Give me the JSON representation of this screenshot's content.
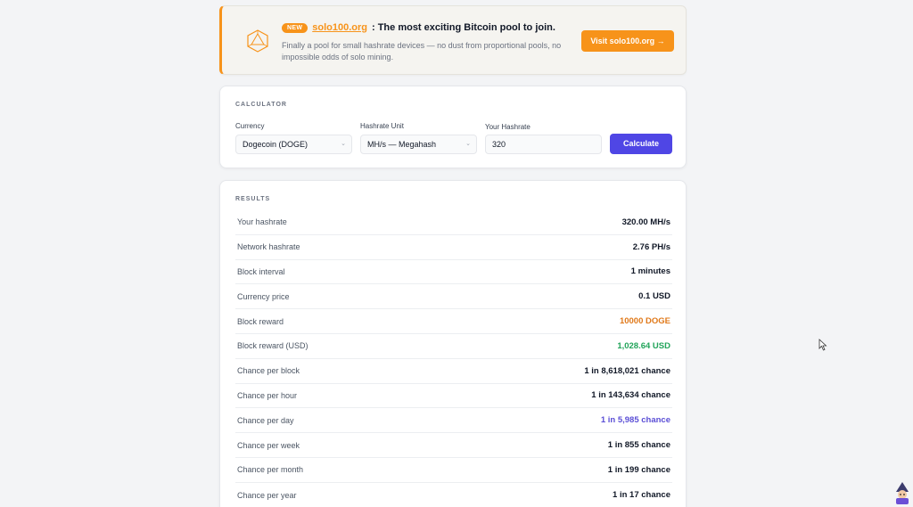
{
  "banner": {
    "badge": "NEW",
    "link": "solo100.org",
    "title": ": The most exciting Bitcoin pool to join.",
    "subtitle": "Finally a pool for small hashrate devices — no dust from proportional pools, no impossible odds of solo mining.",
    "button": "Visit solo100.org →",
    "accent": "#f7931a"
  },
  "calculator": {
    "section": "CALCULATOR",
    "currency_label": "Currency",
    "currency_value": "Dogecoin (DOGE)",
    "unit_label": "Hashrate Unit",
    "unit_value": "MH/s — Megahash",
    "hashrate_label": "Your Hashrate",
    "hashrate_value": "320",
    "button": "Calculate",
    "button_color": "#4f46e5"
  },
  "results": {
    "section": "RESULTS",
    "rows": [
      {
        "label": "Your hashrate",
        "value": "320.00 MH/s",
        "color": "#111827"
      },
      {
        "label": "Network hashrate",
        "value": "2.76 PH/s",
        "color": "#111827"
      },
      {
        "label": "Block interval",
        "value": "1 minutes",
        "color": "#111827"
      },
      {
        "label": "Currency price",
        "value": "0.1 USD",
        "color": "#111827"
      },
      {
        "label": "Block reward",
        "value": "10000 DOGE",
        "color": "#e0791a"
      },
      {
        "label": "Block reward (USD)",
        "value": "1,028.64 USD",
        "color": "#22a45a"
      },
      {
        "label": "Chance per block",
        "value": "1 in 8,618,021 chance",
        "color": "#111827"
      },
      {
        "label": "Chance per hour",
        "value": "1 in 143,634 chance",
        "color": "#111827"
      },
      {
        "label": "Chance per day",
        "value": "1 in 5,985 chance",
        "color": "#5b4fd6"
      },
      {
        "label": "Chance per week",
        "value": "1 in 855 chance",
        "color": "#111827"
      },
      {
        "label": "Chance per month",
        "value": "1 in 199 chance",
        "color": "#111827"
      },
      {
        "label": "Chance per year",
        "value": "1 in 17 chance",
        "color": "#111827"
      }
    ]
  }
}
